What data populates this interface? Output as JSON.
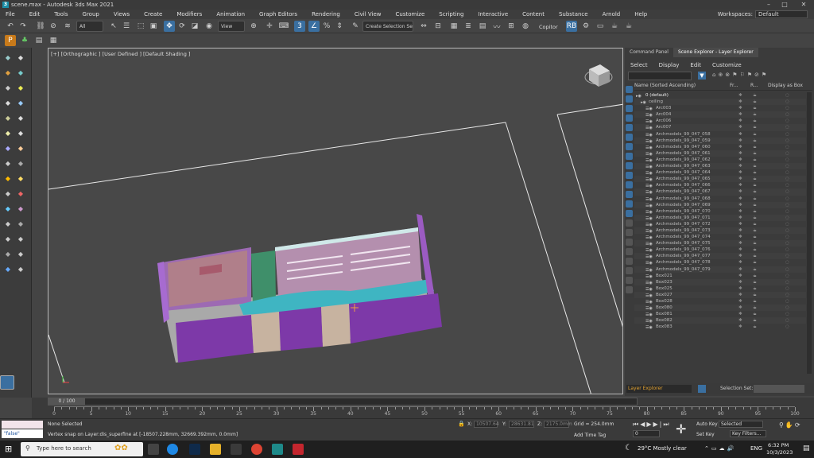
{
  "window": {
    "title": "scene.max - Autodesk 3ds Max 2021",
    "workspaces_label": "Workspaces:",
    "workspaces_value": "Default",
    "minimize": "–",
    "maximize": "□",
    "close": "✕"
  },
  "menubar": [
    "File",
    "Edit",
    "Tools",
    "Group",
    "Views",
    "Create",
    "Modifiers",
    "Animation",
    "Graph Editors",
    "Rendering",
    "Civil View",
    "Customize",
    "Scripting",
    "Interactive",
    "Content",
    "Substance",
    "Arnold",
    "Help"
  ],
  "toolbar": {
    "filter_value": "All",
    "view_value": "View",
    "selection_set_placeholder": "Create Selection Se",
    "copitor": "Copitor"
  },
  "viewport": {
    "label": "[+] [Orthographic ] [User Defined ] [Default Shading ]"
  },
  "right_panel": {
    "tabs": [
      "Command Panel",
      "Scene Explorer - Layer Explorer"
    ],
    "menu": [
      "Select",
      "Display",
      "Edit",
      "Customize"
    ],
    "columns": [
      "Name (Sorted Ascending)",
      "Fr...",
      "R...",
      "Display as Box"
    ],
    "rows": [
      "0 (default)",
      "ceiling",
      "Arc003",
      "Arc004",
      "Arc006",
      "Arc007",
      "Archmodels_99_047_058",
      "Archmodels_99_047_059",
      "Archmodels_99_047_060",
      "Archmodels_99_047_061",
      "Archmodels_99_047_062",
      "Archmodels_99_047_063",
      "Archmodels_99_047_064",
      "Archmodels_99_047_065",
      "Archmodels_99_047_066",
      "Archmodels_99_047_067",
      "Archmodels_99_047_068",
      "Archmodels_99_047_069",
      "Archmodels_99_047_070",
      "Archmodels_99_047_071",
      "Archmodels_99_047_072",
      "Archmodels_99_047_073",
      "Archmodels_99_047_074",
      "Archmodels_99_047_075",
      "Archmodels_99_047_076",
      "Archmodels_99_047_077",
      "Archmodels_99_047_078",
      "Archmodels_99_047_079",
      "Box021",
      "Box023",
      "Box025",
      "Box027",
      "Box028",
      "Box080",
      "Box081",
      "Box082",
      "Box083"
    ],
    "footer_label": "Layer Explorer",
    "selection_set_label": "Selection Set:"
  },
  "timeline": {
    "frame_display": "0 / 100",
    "ticks": [
      "0",
      "5",
      "10",
      "15",
      "20",
      "25",
      "30",
      "35",
      "40",
      "45",
      "50",
      "55",
      "60",
      "65",
      "70",
      "75",
      "80",
      "85",
      "90",
      "95",
      "100"
    ]
  },
  "status": {
    "script_value": "\"false\"",
    "selection": "None Selected",
    "prompt": "Vertex snap on Layer:dis_superfine at [-18507.228mm, 32669.392mm, 0.0mm]",
    "x_label": "X:",
    "x_value": "10507.64",
    "y_label": "Y:",
    "y_value": "28631.81",
    "z_label": "Z:",
    "z_value": "2175.0mm",
    "grid": "Grid = 254.0mm",
    "add_time_tag": "Add Time Tag",
    "auto_key": "Auto Key",
    "set_key": "Set Key",
    "selected": "Selected",
    "key_filters": "Key Filters...",
    "current_frame": "0",
    "one_label": "1"
  },
  "taskbar": {
    "search_placeholder": "Type here to search",
    "weather": "29°C  Mostly clear",
    "lang": "ENG",
    "time": "6:32 PM",
    "date": "10/3/2023"
  }
}
